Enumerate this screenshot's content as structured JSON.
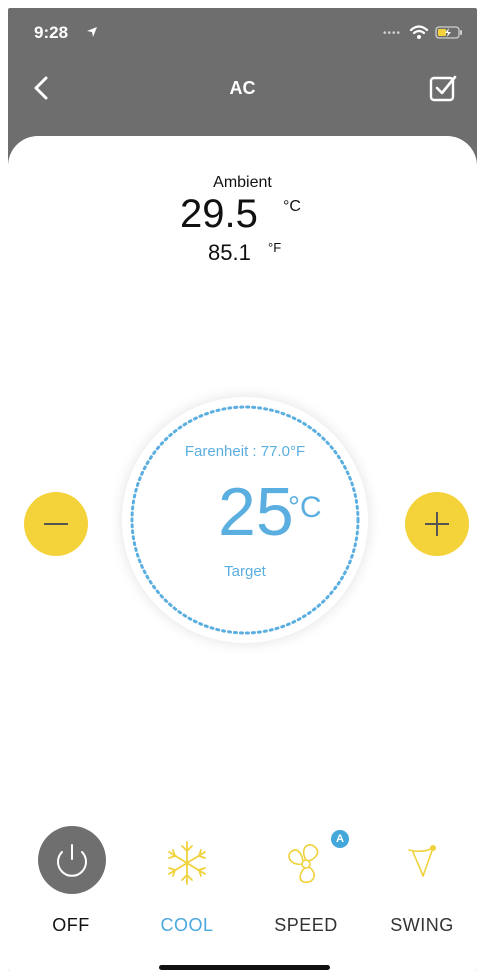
{
  "status_bar": {
    "time": "9:28"
  },
  "nav": {
    "title": "AC"
  },
  "ambient": {
    "label": "Ambient",
    "celsius": "29.5",
    "celsius_unit": "°C",
    "fahrenheit": "85.1",
    "fahrenheit_unit": "°F"
  },
  "target": {
    "fahrenheit_text": "Farenheit : 77.0°F",
    "value": "25",
    "unit": "°C",
    "label": "Target"
  },
  "controls": [
    {
      "label": "OFF",
      "color": "#111111"
    },
    {
      "label": "COOL",
      "color": "#4aa8dd"
    },
    {
      "label": "SPEED",
      "color": "#333333",
      "badge": "A"
    },
    {
      "label": "SWING",
      "color": "#333333"
    }
  ],
  "colors": {
    "header": "#6e6e6e",
    "accent_blue": "#5aaee0",
    "button_yellow": "#f4d33a",
    "icon_yellow": "#f0d23c"
  }
}
